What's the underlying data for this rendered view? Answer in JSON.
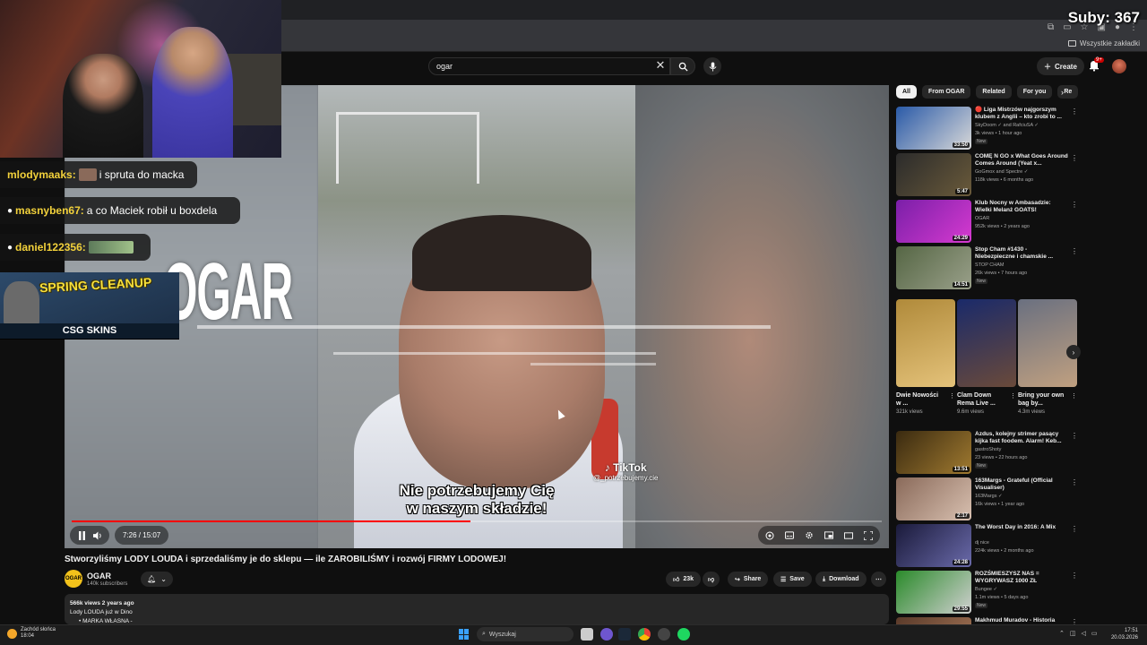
{
  "overlay": {
    "subs_counter": "Suby: 367"
  },
  "chat": {
    "messages": [
      {
        "user": "mlodymaaks:",
        "text": "i spruta do macka"
      },
      {
        "user": "masnyben67:",
        "text": "a co Maciek robił u boxdela"
      },
      {
        "user": "daniel122356:",
        "text": ""
      }
    ]
  },
  "ad": {
    "title": "SPRING CLEANUP",
    "brand": "CSG SKINS"
  },
  "browser": {
    "bookmarks_all": "Wszystkie zakładki"
  },
  "header": {
    "search_query": "ogar",
    "create_label": "Create",
    "notif_badge": "9+"
  },
  "player": {
    "logo": "OGAR",
    "subtitle_line1": "Nie potrzebujemy Cię",
    "subtitle_line2": "w naszym składzie!",
    "tiktok_label": "TikTok",
    "tiktok_handle": "@_potrzebujemy.cie",
    "time": "7:26 / 15:07",
    "progress": 0.492
  },
  "video": {
    "title": "Stworzyliśmy LODY LOUDA i sprzedaliśmy je do sklepu — ile ZAROBILIŚMY i rozwój FIRMY LODOWEJ!",
    "channel": "OGAR",
    "channel_logo": "OGAR",
    "subscribers": "140k subscribers",
    "likes": "23k",
    "share": "Share",
    "save": "Save",
    "download": "Download",
    "description_meta": "566k views  2 years ago",
    "description_line1": "Lody LOUDA już w Dino",
    "description_line2": "• MARKA WŁASNA -"
  },
  "sidebar": {
    "chips": [
      "All",
      "From OGAR",
      "Related",
      "For you",
      "Re"
    ],
    "recs_top": [
      {
        "title": "🔴 Liga Mistrzów najgorszym klubem z Anglii – kto zrobi to ...",
        "channel": "SkyDoom ✓ and RafciuSA ✓",
        "meta": "3k views • 1 hour ago",
        "badge": "New",
        "duration": "33:50",
        "color1": "#2a5aa8",
        "color2": "#d8d8d8"
      },
      {
        "title": "COMĘ N GO x What Goes Around Comes Around (Yeat x...",
        "channel": "GoGmox and Spectre ✓",
        "meta": "118k views • 6 months ago",
        "badge": "",
        "duration": "5:47",
        "color1": "#2b2b2b",
        "color2": "#6a5a3a"
      },
      {
        "title": "Klub Nocny w Ambasadzie: Wielki Melanż GOATS!",
        "channel": "OGAR",
        "meta": "952k views • 2 years ago",
        "badge": "",
        "duration": "24:29",
        "color1": "#7a1fa8",
        "color2": "#d63ad0"
      },
      {
        "title": "Stop Cham #1430 - Niebezpieczne i chamskie ...",
        "channel": "STOP CHAM",
        "meta": "26k views • 7 hours ago",
        "badge": "New",
        "duration": "14:51",
        "color1": "#556644",
        "color2": "#9aa08a"
      }
    ],
    "shorts": [
      {
        "title": "Dwie Nowości w ...",
        "views": "321k views",
        "color1": "#b08a3a",
        "color2": "#e4c27a"
      },
      {
        "title": "Clam Down Rema Live ...",
        "views": "9.6m views",
        "color1": "#1a2a6a",
        "color2": "#6a4a3a"
      },
      {
        "title": "Bring your own bag by...",
        "views": "4.3m views",
        "color1": "#6a7080",
        "color2": "#c0a080"
      }
    ],
    "recs_bottom": [
      {
        "title": "Azdus, kolejny strimer pasący kijka fast foodem. Alarm! Keb...",
        "channel": "gastroShoty",
        "meta": "23 views • 22 hours ago",
        "badge": "New",
        "duration": "13:51",
        "color1": "#3a2a10",
        "color2": "#a07a30"
      },
      {
        "title": "163Margs - Grateful (Official Visualiser)",
        "channel": "163Margs ✓",
        "meta": "16k views • 1 year ago",
        "badge": "",
        "duration": "2:17",
        "color1": "#8a6a5a",
        "color2": "#d8c0b0"
      },
      {
        "title": "The Worst Day in 2016: A Mix",
        "channel": "dj nice",
        "meta": "224k views • 2 months ago",
        "badge": "",
        "duration": "24:28",
        "color1": "#1a1a3a",
        "color2": "#6a6aaa"
      },
      {
        "title": "ROZŚMIESZYSZ NAS = WYGRYWASZ 1000 ZŁ",
        "channel": "Bungee ✓",
        "meta": "1.1m views • 5 days ago",
        "badge": "New",
        "duration": "29:55",
        "color1": "#2a8a2a",
        "color2": "#d0d0d0"
      },
      {
        "title": "Makhmud Muradov - Historia",
        "channel": "",
        "meta": "",
        "badge": "",
        "duration": "",
        "color1": "#5a3a2a",
        "color2": "#aa7a5a"
      }
    ]
  },
  "taskbar": {
    "weather_title": "Zachód słońca",
    "weather_time": "18:04",
    "search_label": "Wyszukaj",
    "clock_time": "17:51",
    "clock_date": "20.03.2026"
  },
  "colors": {
    "accent_red": "#ff0000",
    "chat_username": "#f2d13b",
    "channel_logo": "#f2c21b"
  }
}
